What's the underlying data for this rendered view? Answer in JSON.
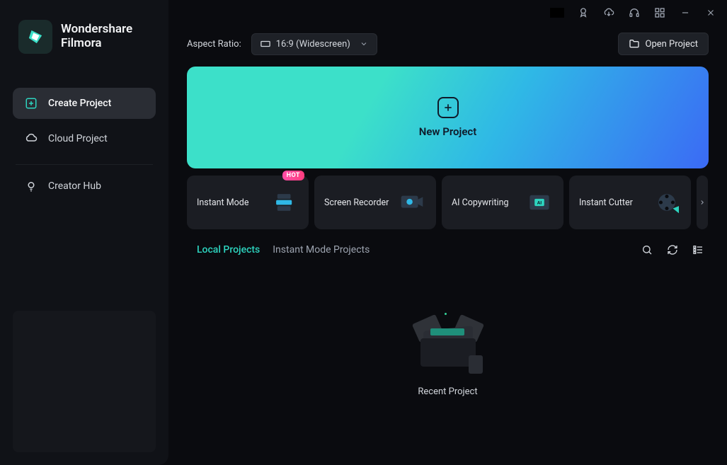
{
  "brand": {
    "line1": "Wondershare",
    "line2": "Filmora"
  },
  "sidebar": {
    "items": [
      {
        "label": "Create Project"
      },
      {
        "label": "Cloud Project"
      },
      {
        "label": "Creator Hub"
      }
    ]
  },
  "topbar": {
    "aspect_ratio_label": "Aspect Ratio:",
    "aspect_ratio_value": "16:9 (Widescreen)",
    "open_project_label": "Open Project"
  },
  "new_project": {
    "label": "New Project"
  },
  "cards": [
    {
      "label": "Instant Mode",
      "badge": "HOT"
    },
    {
      "label": "Screen Recorder"
    },
    {
      "label": "AI Copywriting"
    },
    {
      "label": "Instant Cutter"
    }
  ],
  "tabs": [
    {
      "label": "Local Projects",
      "active": true
    },
    {
      "label": "Instant Mode Projects",
      "active": false
    }
  ],
  "recent": {
    "label": "Recent Project"
  },
  "colors": {
    "accent": "#2dd4bf",
    "gradient_start": "#3ce0c9",
    "gradient_end": "#3b6af5",
    "badge": "#ff3d7f"
  }
}
